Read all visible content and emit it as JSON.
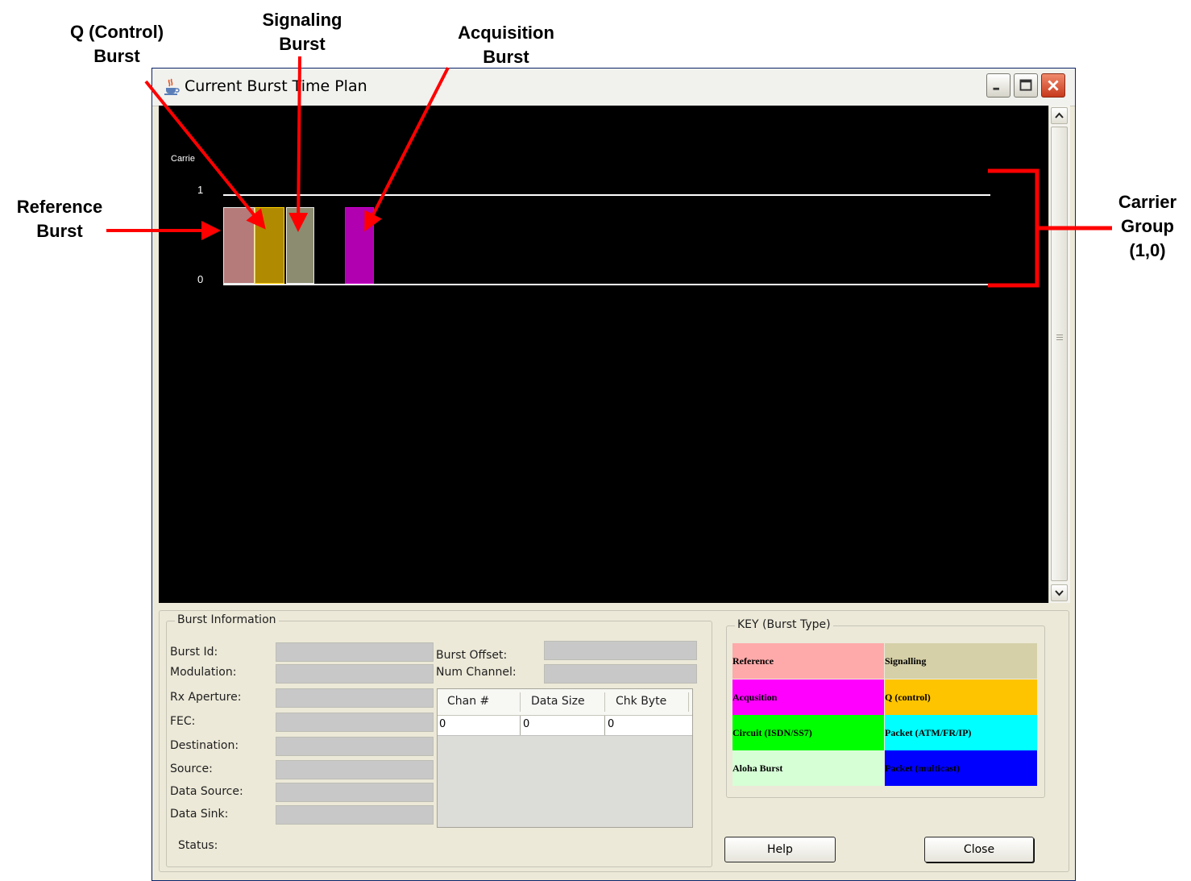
{
  "callouts": {
    "q_control": "Q (Control)\nBurst",
    "signaling": "Signaling\nBurst",
    "acquisition": "Acquisition\nBurst",
    "reference": "Reference\nBurst",
    "carrier_group": "Carrier\nGroup\n(1,0)",
    "arrow_color": "#ff0000"
  },
  "window": {
    "title": "Current Burst Time Plan",
    "icon": "java-cup-icon"
  },
  "plot": {
    "background": "#000000",
    "axis_title": "Carrie",
    "ticks": [
      "1",
      "0"
    ],
    "bursts": [
      {
        "type": "Reference",
        "color": "#b57a7a"
      },
      {
        "type": "Q (control)",
        "color": "#b08a00"
      },
      {
        "type": "Signalling",
        "color": "#8c8c70"
      },
      {
        "type": "Acquisition",
        "color": "#b000b0"
      }
    ]
  },
  "burst_info": {
    "title": "Burst Information",
    "labels": {
      "burst_id": "Burst Id:",
      "modulation": "Modulation:",
      "rx_aperture": "Rx Aperture:",
      "fec": "FEC:",
      "destination": "Destination:",
      "source": "Source:",
      "data_source": "Data Source:",
      "data_sink": "Data Sink:",
      "status": "Status:",
      "burst_offset": "Burst Offset:",
      "num_channel": "Num Channel:"
    },
    "values": {
      "burst_id": "",
      "modulation": "",
      "rx_aperture": "",
      "fec": "",
      "destination": "",
      "source": "",
      "data_source": "",
      "data_sink": "",
      "burst_offset": "",
      "num_channel": ""
    },
    "channel_table": {
      "columns": [
        "Chan #",
        "Data Size",
        "Chk Byte"
      ],
      "rows": [
        [
          "0",
          "0",
          "0"
        ]
      ]
    }
  },
  "key": {
    "title": "KEY (Burst Type)",
    "items": [
      {
        "label": "Reference",
        "color": "#ffaaaa",
        "text_color": "#000000"
      },
      {
        "label": "Signalling",
        "color": "#d6d0a8",
        "text_color": "#000000"
      },
      {
        "label": "Acqusition",
        "color": "#ff00ff",
        "text_color": "#000000"
      },
      {
        "label": "Q (control)",
        "color": "#ffc400",
        "text_color": "#000000"
      },
      {
        "label": "Circuit (ISDN/SS7)",
        "color": "#00ff00",
        "text_color": "#000000"
      },
      {
        "label": "Packet (ATM/FR/IP)",
        "color": "#00ffff",
        "text_color": "#000000"
      },
      {
        "label": "Aloha Burst",
        "color": "#d6ffd6",
        "text_color": "#000000"
      },
      {
        "label": "Packet (multicast)",
        "color": "#0000ff",
        "text_color": "#000000"
      }
    ]
  },
  "buttons": {
    "help": "Help",
    "close": "Close"
  }
}
